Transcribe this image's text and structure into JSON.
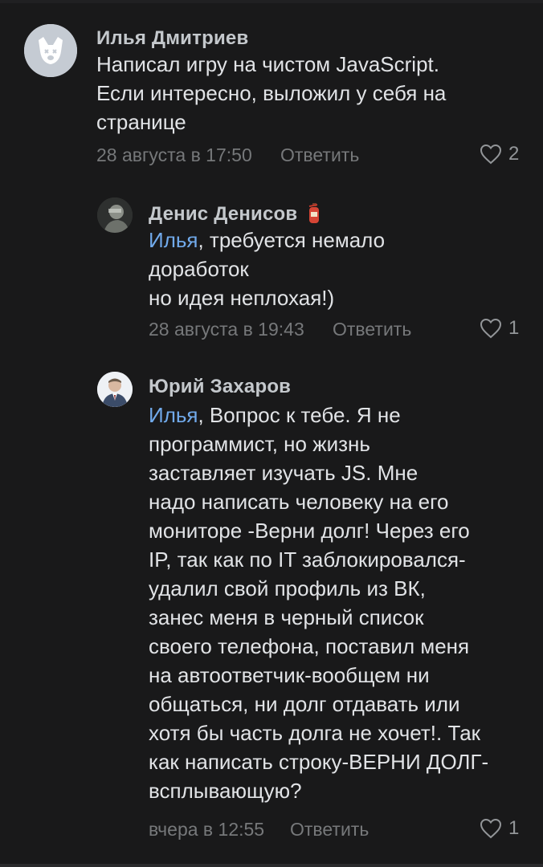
{
  "comments": [
    {
      "author": "Илья Дмитриев",
      "lines": [
        "Написал игру на чистом JavaScript.",
        "Если интересно, выложил у себя на",
        "странице"
      ],
      "date": "28 августа в 17:50",
      "reply_label": "Ответить",
      "likes": "2",
      "avatar_icon": "dog-placeholder-icon"
    },
    {
      "author": "Денис Денисов",
      "author_badge_icon": "fire-extinguisher-icon",
      "mention": "Илья",
      "first_line_rest": ", требуется немало",
      "lines": [
        "доработок",
        "но идея неплохая!)"
      ],
      "date": "28 августа в 19:43",
      "reply_label": "Ответить",
      "likes": "1",
      "avatar_icon": "user-photo-icon"
    },
    {
      "author": "Юрий Захаров",
      "mention": "Илья",
      "first_line_rest": ", Вопрос к тебе. Я не",
      "lines": [
        "программист, но жизнь",
        "заставляет изучать JS. Мне",
        "надо написать человеку на его",
        "мониторе -Верни долг! Через его",
        "IP, так как по IT заблокировался-",
        "удалил свой профиль из ВК,",
        "занес меня в черный список",
        "своего телефона, поставил меня",
        "на автоответчик-вообщем ни",
        "общаться, ни долг отдавать или",
        "хотя бы часть долга не хочет!. Так",
        "как написать строку-ВЕРНИ ДОЛГ-",
        "всплывающую?"
      ],
      "date": "вчера в 12:55",
      "reply_label": "Ответить",
      "likes": "1",
      "avatar_icon": "user-photo-icon"
    }
  ],
  "colors": {
    "background": "#19191a",
    "text": "#e1e3e6",
    "author": "#c4c8cc",
    "meta": "#76787a",
    "mention": "#71aaeb"
  }
}
